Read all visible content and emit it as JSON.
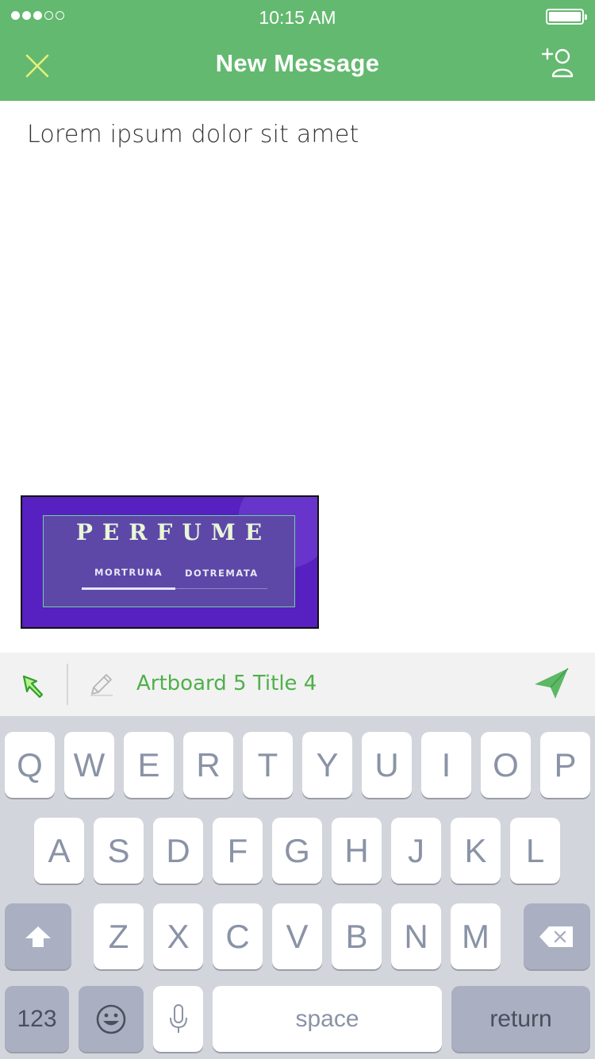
{
  "status_bar": {
    "signal_total": 5,
    "signal_filled": 3,
    "time": "10:15 AM",
    "battery_level": 1.0
  },
  "header": {
    "title": "New Message",
    "close_icon": "close-icon",
    "add_person_icon": "add-person-icon",
    "background_color": "#63b96f",
    "close_color": "#e4f07a"
  },
  "message": {
    "text": "Lorem ipsum dolor sit amet"
  },
  "attachment": {
    "title": "PERFUME",
    "nav_items": [
      "MORTRUNA",
      "DOTREMATA"
    ],
    "active_index": 0
  },
  "composer": {
    "text": "Artboard 5 Title 4",
    "accent_color": "#4fb04a",
    "cursor_icon": "cursor-arrow-icon",
    "pencil_icon": "pencil-icon",
    "send_icon": "send-icon"
  },
  "keyboard": {
    "row1": [
      "Q",
      "W",
      "E",
      "R",
      "T",
      "Y",
      "U",
      "I",
      "O",
      "P"
    ],
    "row2": [
      "A",
      "S",
      "D",
      "F",
      "G",
      "H",
      "J",
      "K",
      "L"
    ],
    "row3": [
      "Z",
      "X",
      "C",
      "V",
      "B",
      "N",
      "M"
    ],
    "numbers_label": "123",
    "space_label": "space",
    "return_label": "return",
    "shift_icon": "shift-icon",
    "backspace_icon": "backspace-icon",
    "emoji_icon": "emoji-icon",
    "mic_icon": "microphone-icon"
  }
}
